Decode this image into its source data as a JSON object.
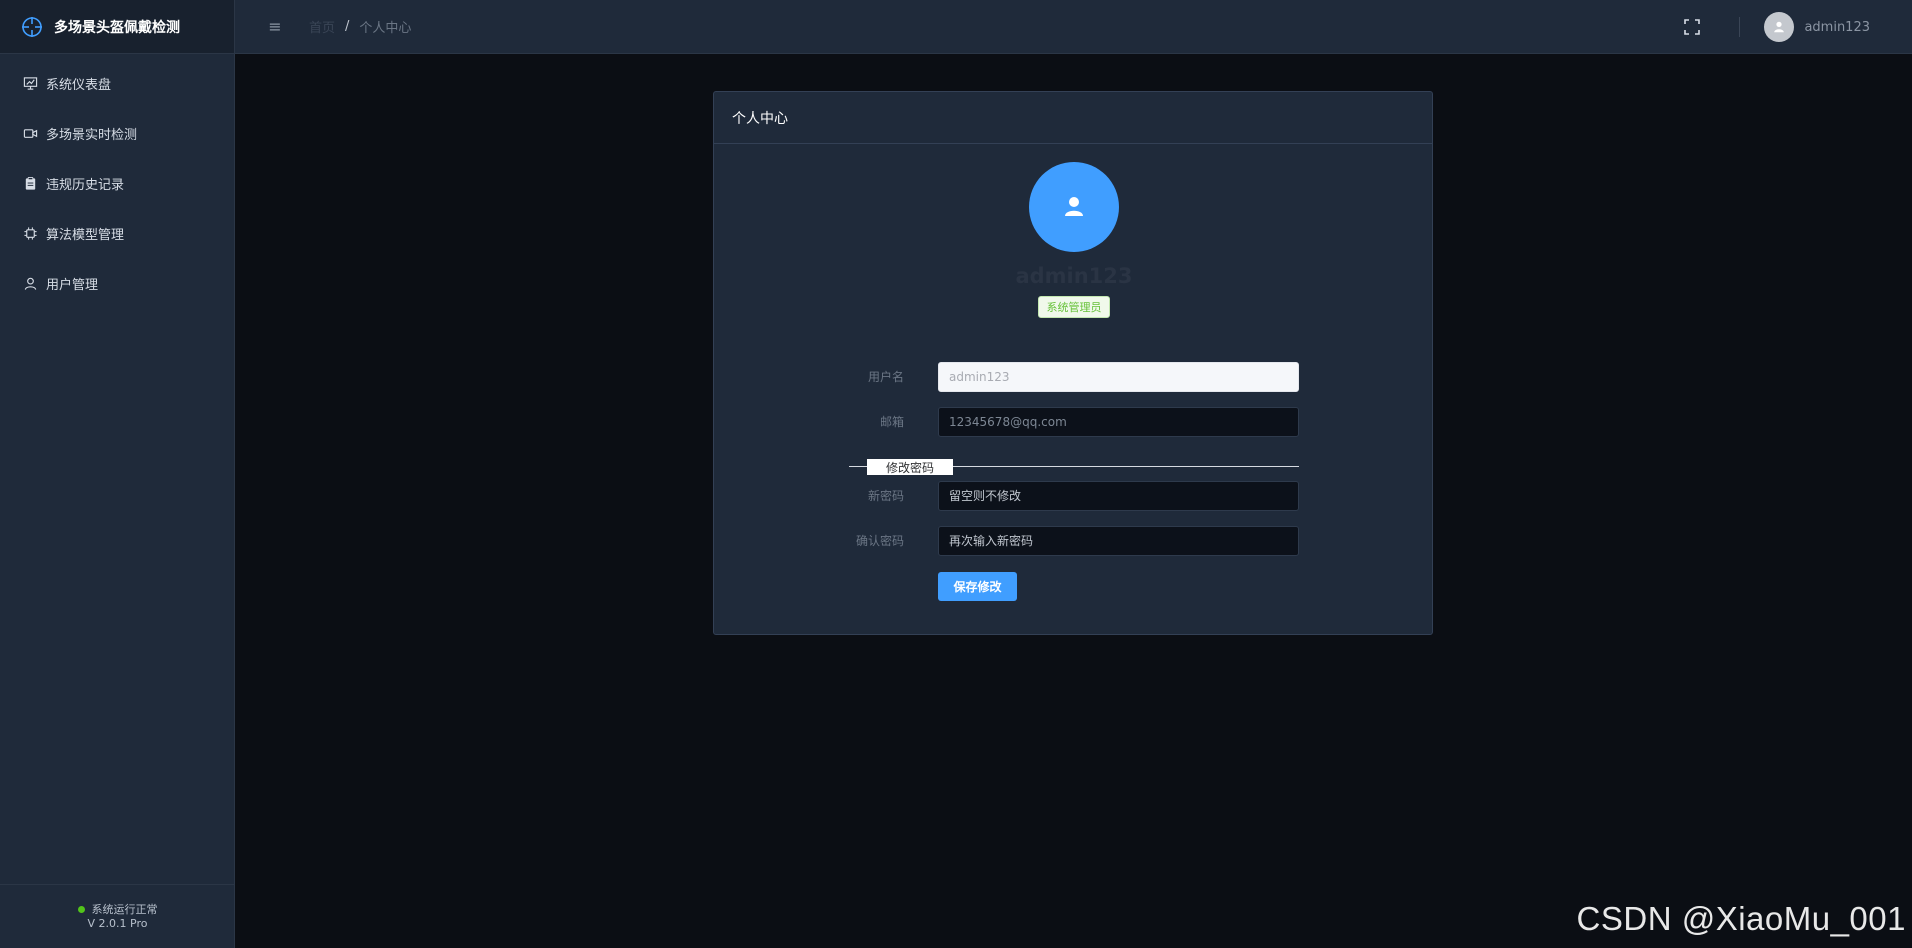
{
  "app": {
    "title": "多场景头盔佩戴检测"
  },
  "sidebar": {
    "items": [
      {
        "label": "系统仪表盘",
        "icon": "dashboard-icon"
      },
      {
        "label": "多场景实时检测",
        "icon": "camera-icon"
      },
      {
        "label": "违规历史记录",
        "icon": "clipboard-icon"
      },
      {
        "label": "算法模型管理",
        "icon": "chip-icon"
      },
      {
        "label": "用户管理",
        "icon": "user-icon"
      }
    ],
    "footer": {
      "status": "系统运行正常",
      "version": "V 2.0.1 Pro"
    }
  },
  "header": {
    "breadcrumb": {
      "home": "首页",
      "separator": "/",
      "current": "个人中心"
    },
    "user": {
      "name": "admin123"
    }
  },
  "profile": {
    "card_title": "个人中心",
    "name": "admin123",
    "role": "系统管理员",
    "form": {
      "username_label": "用户名",
      "username_value": "admin123",
      "email_label": "邮箱",
      "email_value": "12345678@qq.com",
      "divider": "修改密码",
      "new_password_label": "新密码",
      "new_password_placeholder": "留空则不修改",
      "confirm_password_label": "确认密码",
      "confirm_password_placeholder": "再次输入新密码",
      "save_button": "保存修改"
    }
  },
  "watermark": "CSDN @XiaoMu_001",
  "colors": {
    "primary": "#409eff",
    "sidebar_bg": "#1f2a3a",
    "page_bg": "#0b0e14",
    "success": "#52c41a"
  }
}
